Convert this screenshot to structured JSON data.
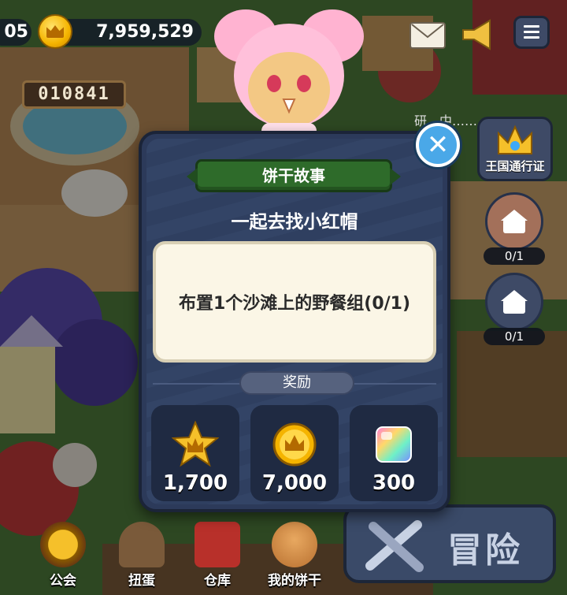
{
  "hud": {
    "left_value": "05",
    "coins": "7,959,529",
    "counter": "010841"
  },
  "side": {
    "pass_label": "王国通行证",
    "quest1_count": "0/1",
    "quest2_count": "0/1",
    "bg_text": "研…中……"
  },
  "modal": {
    "banner": "饼干故事",
    "subtitle": "一起去找小红帽",
    "task": "布置1个沙滩上的野餐组(0/1)",
    "reward_label": "奖励",
    "rewards": [
      {
        "icon": "star-crown-icon",
        "value": "1,700"
      },
      {
        "icon": "coin-icon",
        "value": "7,000"
      },
      {
        "icon": "rainbow-cube-icon",
        "value": "300"
      }
    ],
    "close_glyph": "✕"
  },
  "nav": {
    "guild": "公会",
    "gacha": "扭蛋",
    "storage": "仓库",
    "my_cookies": "我的饼干",
    "adventure": "冒险"
  },
  "colors": {
    "modal_bg": "#2c3a5a",
    "banner_green": "#2e6b2a",
    "close_blue": "#4aa8e8",
    "coin_gold": "#f5b400"
  }
}
